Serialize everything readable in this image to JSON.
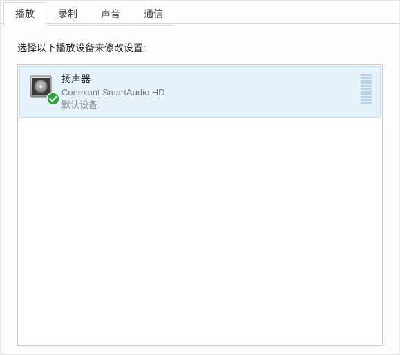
{
  "tabs": {
    "items": [
      {
        "label": "播放",
        "active": true
      },
      {
        "label": "录制",
        "active": false
      },
      {
        "label": "声音",
        "active": false
      },
      {
        "label": "通信",
        "active": false
      }
    ]
  },
  "content": {
    "instruction": "选择以下播放设备来修改设置:"
  },
  "devices": [
    {
      "name": "扬声器",
      "driver": "Conexant SmartAudio HD",
      "status": "默认设备",
      "selected": true,
      "default": true
    }
  ],
  "icons": {
    "speaker": "speaker-icon",
    "check": "checkmark-icon"
  }
}
